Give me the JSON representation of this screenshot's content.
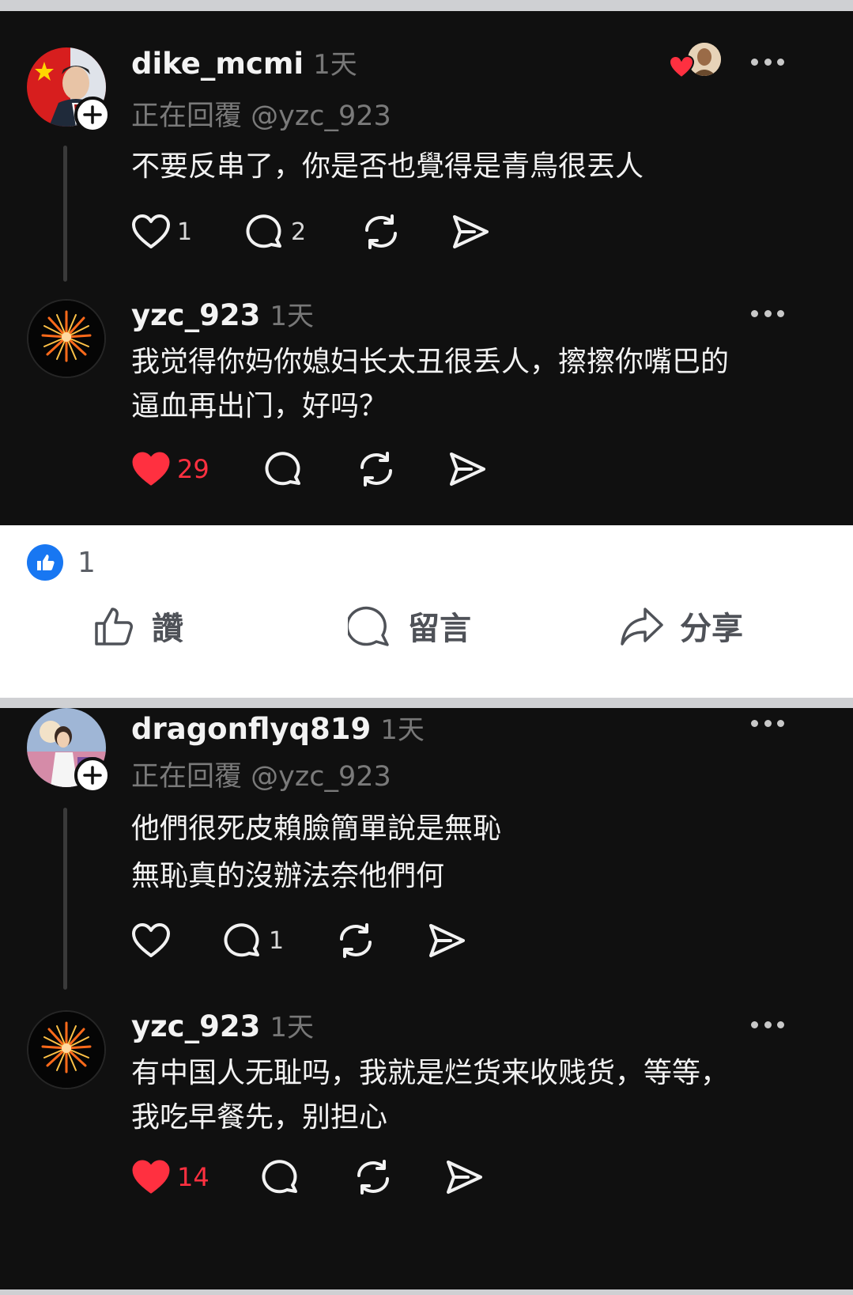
{
  "thread1": {
    "parent": {
      "username": "dike_mcmi",
      "time": "1天",
      "replying": "正在回覆 @yzc_923",
      "text": "不要反串了，你是否也覺得是青鳥很丟人",
      "likes": "1",
      "comments": "2"
    },
    "reply": {
      "username": "yzc_923",
      "time": "1天",
      "line1": "我觉得你妈你媳妇长太丑很丢人，擦擦你嘴巴的",
      "line2": "逼血再出门，好吗？",
      "likes": "29"
    }
  },
  "facebook_bar": {
    "reaction_count": "1",
    "like_label": "讚",
    "comment_label": "留言",
    "share_label": "分享"
  },
  "thread2": {
    "parent": {
      "username": "dragonflyq819",
      "time": "1天",
      "replying": "正在回覆 @yzc_923",
      "line1": "他們很死皮賴臉簡單說是無恥",
      "line2": "無恥真的沒辦法奈他們何",
      "comments": "1"
    },
    "reply": {
      "username": "yzc_923",
      "time": "1天",
      "line1": "有中国人无耻吗，我就是烂货来收贱货，等等，",
      "line2": "我吃早餐先，别担心",
      "likes": "14"
    }
  },
  "colors": {
    "background": "#101010",
    "liked": "#ff3040",
    "facebook_blue": "#1877f2"
  }
}
